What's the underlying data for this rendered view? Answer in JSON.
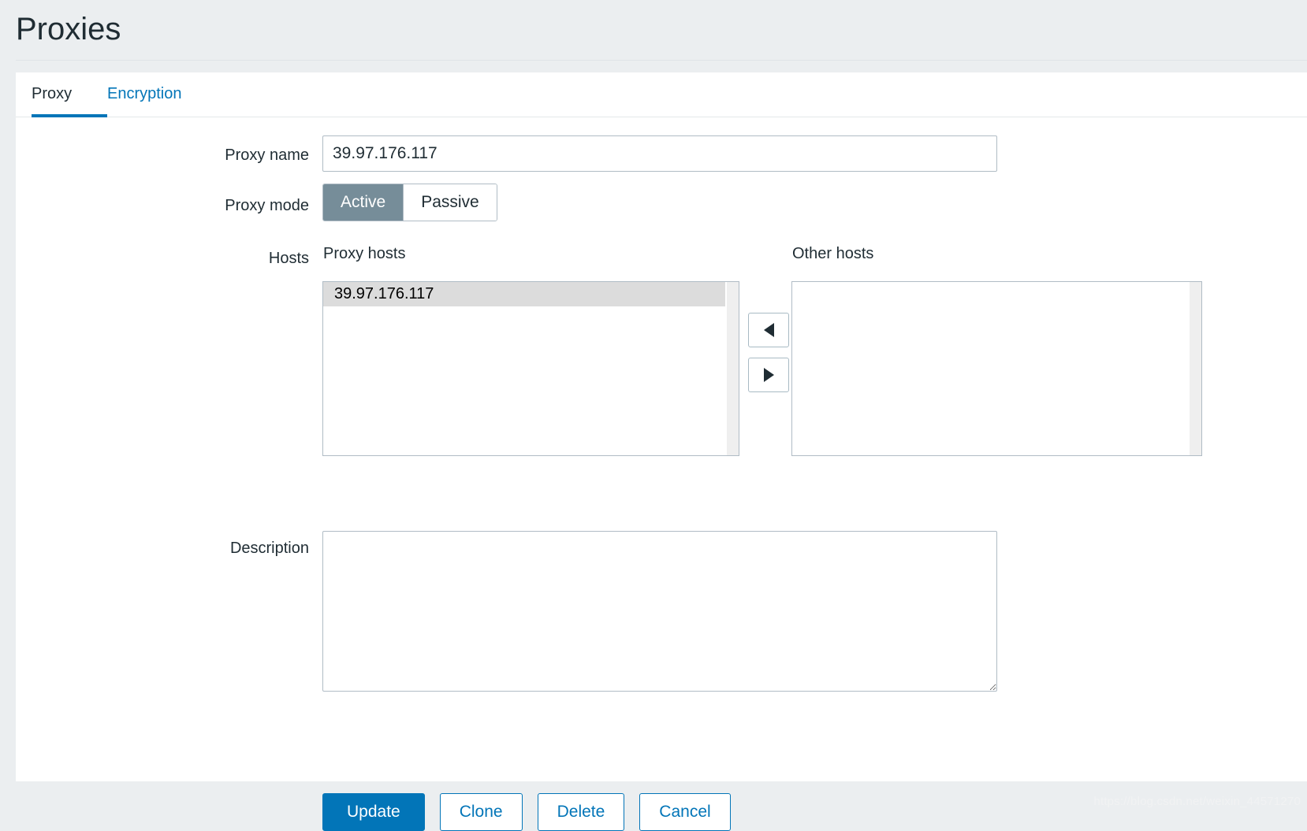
{
  "header": {
    "title": "Proxies"
  },
  "tabs": [
    {
      "id": "proxy",
      "label": "Proxy",
      "active": true
    },
    {
      "id": "encryption",
      "label": "Encryption",
      "active": false
    }
  ],
  "form": {
    "proxy_name": {
      "label": "Proxy name",
      "value": "39.97.176.117",
      "placeholder": ""
    },
    "proxy_mode": {
      "label": "Proxy mode",
      "options": [
        "Active",
        "Passive"
      ],
      "selected": "Active"
    },
    "hosts": {
      "label": "Hosts",
      "proxy_hosts": {
        "title": "Proxy hosts",
        "items": [
          "39.97.176.117"
        ],
        "selected": "39.97.176.117"
      },
      "other_hosts": {
        "title": "Other hosts",
        "items": []
      },
      "move_left_icon": "arrow-left-icon",
      "move_right_icon": "arrow-right-icon"
    },
    "description": {
      "label": "Description",
      "value": "",
      "placeholder": ""
    }
  },
  "actions": {
    "update": "Update",
    "clone": "Clone",
    "delete": "Delete",
    "cancel": "Cancel"
  },
  "watermark": "https://blog.csdn.net/weixin_44571270",
  "colors": {
    "accent": "#0275b8",
    "page_background": "#ebeef0",
    "card_background": "#ffffff",
    "selected_segment": "#768d99",
    "list_selection": "#dcdcdc",
    "border": "#b0bcc5"
  }
}
